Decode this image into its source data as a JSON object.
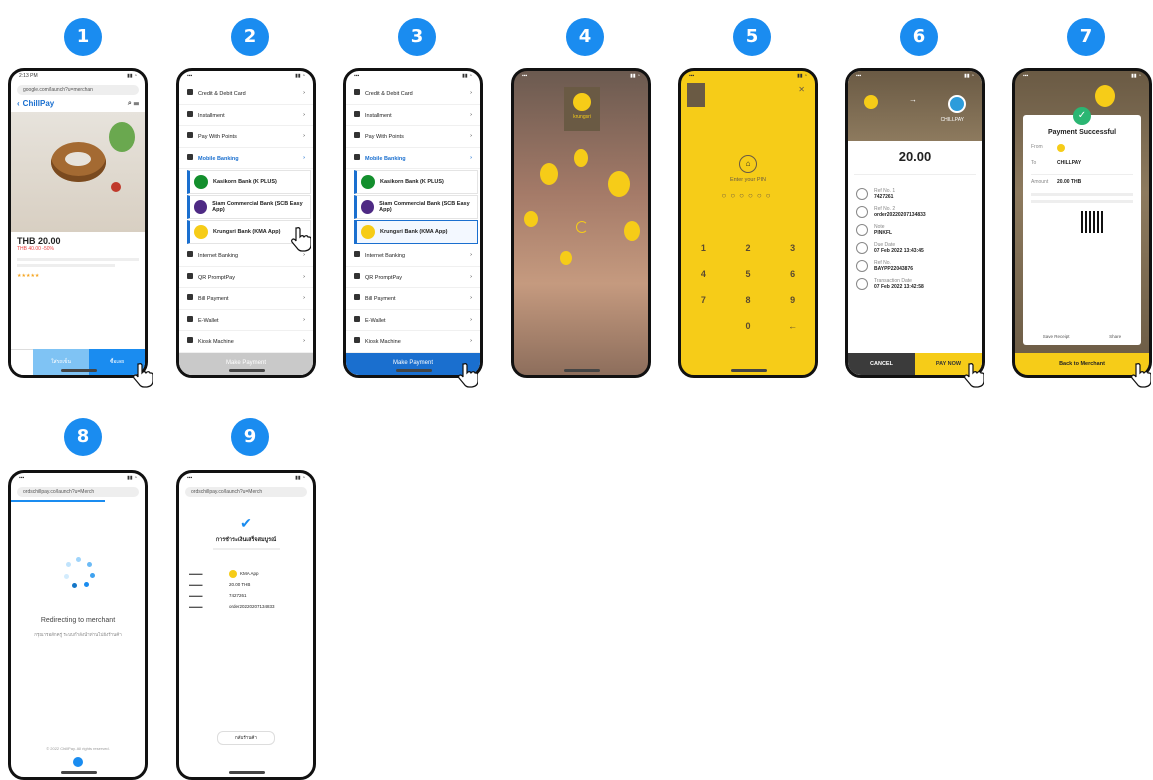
{
  "steps": {
    "s1": {
      "badge": "1",
      "status_time": "2:13 PM",
      "url": "google.com/launch?u=merchan",
      "brand": "ChillPay",
      "price": "THB 20.00",
      "old_price": "THB 40.00 -50%",
      "btn_left": "ใส่รถเข็น",
      "btn_right": "ซื้อเลย"
    },
    "s2": {
      "badge": "2",
      "menu": [
        "Credit & Debit Card",
        "Installment",
        "Pay With Points",
        "Mobile Banking"
      ],
      "banks": [
        "Kasikorn Bank (K PLUS)",
        "Siam Commercial Bank (SCB Easy App)",
        "Krungsri Bank (KMA App)"
      ],
      "menu2": [
        "Internet Banking",
        "QR PromptPay",
        "Bill Payment",
        "E-Wallet",
        "Kiosk Machine"
      ],
      "pay_label": "Make Payment"
    },
    "s3": {
      "badge": "3",
      "pay_label": "Make Payment"
    },
    "s4": {
      "badge": "4",
      "app": "krungsri"
    },
    "s5": {
      "badge": "5",
      "prompt": "Enter your PIN",
      "keys": [
        "1",
        "2",
        "3",
        "4",
        "5",
        "6",
        "7",
        "8",
        "9",
        "",
        "0",
        "←"
      ]
    },
    "s6": {
      "badge": "6",
      "amount": "20.00",
      "cancel": "CANCEL",
      "pay_now": "PAY NOW",
      "to": "CHILLPAY",
      "rows": [
        "Ref No. 1",
        "7427261",
        "Ref No. 2",
        "order20220207134833",
        "Note",
        "PINKFL",
        "Due Date",
        "07 Feb 2022 13:43:45",
        "Ref No.",
        "BAYPP22043876",
        "Transaction Date",
        "07 Feb 2022 13:42:58"
      ]
    },
    "s7": {
      "badge": "7",
      "title": "Payment Successful",
      "amount": "20.00 THB",
      "to": "CHILLPAY",
      "save": "Save Receipt",
      "share": "Share",
      "back": "Back to Merchant"
    },
    "s8": {
      "badge": "8",
      "url": "ordschillpay.co/launch?u=Merch",
      "title": "Redirecting to merchant",
      "sub": "กรุณารอสักครู่ ระบบกำลังนำท่านไปยังร้านค้า",
      "footer": "© 2022 ChillPay. All rights reserved."
    },
    "s9": {
      "badge": "9",
      "title": "การชำระเงินเสร็จสมบูรณ์",
      "app_label": "KMA App",
      "amount": "20.00 THB",
      "ref": "7427261",
      "order": "order20220207134833",
      "back": "กลับร้านค้า"
    }
  },
  "colors": {
    "blue": "#1a8cf0",
    "krungsri": "#f6cc18",
    "dark": "#3b3b3b"
  }
}
